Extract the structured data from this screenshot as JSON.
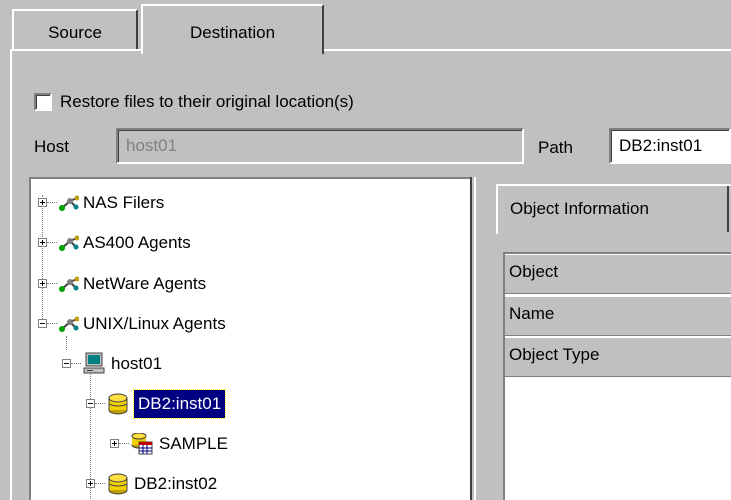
{
  "tabs": [
    {
      "label": "Source"
    },
    {
      "label": "Destination"
    }
  ],
  "restore_checkbox": {
    "label": "Restore files to their original location(s)",
    "checked": false
  },
  "host": {
    "label": "Host",
    "value": "host01"
  },
  "path": {
    "label": "Path",
    "value": "DB2:inst01"
  },
  "tree": {
    "nodes": [
      {
        "label": "NAS Filers",
        "icon": "network-icon",
        "expander": "plus"
      },
      {
        "label": "AS400 Agents",
        "icon": "network-icon",
        "expander": "plus"
      },
      {
        "label": "NetWare Agents",
        "icon": "network-icon",
        "expander": "plus"
      },
      {
        "label": "UNIX/Linux Agents",
        "icon": "network-icon",
        "expander": "minus"
      },
      {
        "label": "host01",
        "icon": "computer-icon",
        "expander": "minus"
      },
      {
        "label": "DB2:inst01",
        "icon": "database-icon",
        "expander": "minus",
        "selected": true
      },
      {
        "label": "SAMPLE",
        "icon": "database-table-icon",
        "expander": "plus"
      },
      {
        "label": "DB2:inst02",
        "icon": "database-icon",
        "expander": "plus"
      }
    ]
  },
  "info_panel": {
    "tab_label": "Object Information",
    "rows": [
      {
        "label": "Object"
      },
      {
        "label": "Name"
      },
      {
        "label": "Object Type"
      }
    ]
  },
  "colors": {
    "selection": "#000080",
    "background": "#c0c0c0"
  }
}
